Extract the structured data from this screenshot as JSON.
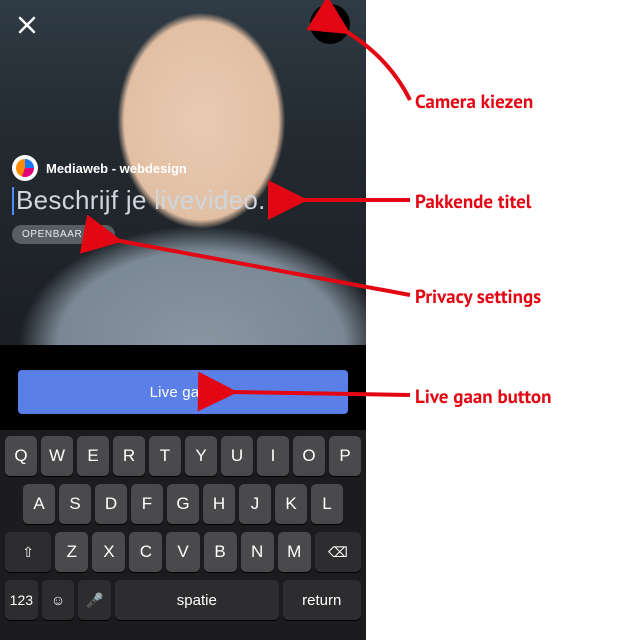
{
  "phone": {
    "page_name": "Mediaweb - webdesign",
    "title_placeholder": "Beschrijf je livevideo...",
    "privacy_label": "OPENBAAR",
    "live_button": "Live gaan"
  },
  "keyboard": {
    "rows": [
      [
        "Q",
        "W",
        "E",
        "R",
        "T",
        "Y",
        "U",
        "I",
        "O",
        "P"
      ],
      [
        "A",
        "S",
        "D",
        "F",
        "G",
        "H",
        "J",
        "K",
        "L"
      ],
      [
        "Z",
        "X",
        "C",
        "V",
        "B",
        "N",
        "M"
      ]
    ],
    "shift": "⇧",
    "backspace": "⌫",
    "numbers": "123",
    "emoji": "☺",
    "mic": "🎤",
    "space": "spatie",
    "return": "return"
  },
  "annotations": {
    "camera": "Camera kiezen",
    "title": "Pakkende titel",
    "privacy": "Privacy settings",
    "live": "Live gaan button"
  },
  "colors": {
    "accent_blue": "#5a80e8",
    "annotation_red": "#e30613"
  }
}
